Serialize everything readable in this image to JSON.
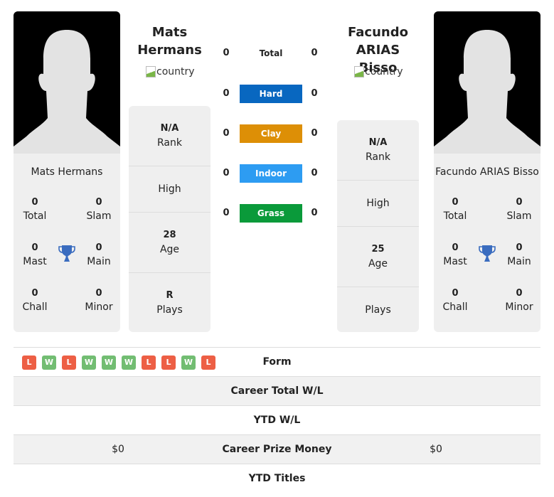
{
  "colors": {
    "hard": "#0867c0",
    "clay": "#dd8f06",
    "indoor": "#2d9cf2",
    "grass": "#0a9a3a",
    "win": "#72bd72",
    "loss": "#ed5f45",
    "trophy": "#3a6cbf"
  },
  "player1": {
    "name": "Mats Hermans",
    "name_line1": "Mats",
    "name_line2": "Hermans",
    "flag_alt": "country",
    "rank": "N/A",
    "rank_label": "Rank",
    "high_label": "High",
    "age": "28",
    "age_label": "Age",
    "plays": "R",
    "plays_label": "Plays",
    "titles": {
      "total": "0",
      "total_label": "Total",
      "slam": "0",
      "slam_label": "Slam",
      "mast": "0",
      "mast_label": "Mast",
      "main": "0",
      "main_label": "Main",
      "chall": "0",
      "chall_label": "Chall",
      "minor": "0",
      "minor_label": "Minor"
    }
  },
  "player2": {
    "name": "Facundo ARIAS Bisso",
    "name_line1": "Facundo ARIAS",
    "name_line2": "Bisso",
    "flag_alt": "country",
    "rank": "N/A",
    "rank_label": "Rank",
    "high_label": "High",
    "age": "25",
    "age_label": "Age",
    "plays": "",
    "plays_label": "Plays",
    "titles": {
      "total": "0",
      "total_label": "Total",
      "slam": "0",
      "slam_label": "Slam",
      "mast": "0",
      "mast_label": "Mast",
      "main": "0",
      "main_label": "Main",
      "chall": "0",
      "chall_label": "Chall",
      "minor": "0",
      "minor_label": "Minor"
    }
  },
  "h2h": [
    {
      "label": "Total",
      "p1": "0",
      "p2": "0",
      "surface": "total"
    },
    {
      "label": "Hard",
      "p1": "0",
      "p2": "0",
      "surface": "hard"
    },
    {
      "label": "Clay",
      "p1": "0",
      "p2": "0",
      "surface": "clay"
    },
    {
      "label": "Indoor",
      "p1": "0",
      "p2": "0",
      "surface": "indoor"
    },
    {
      "label": "Grass",
      "p1": "0",
      "p2": "0",
      "surface": "grass"
    }
  ],
  "form": [
    "L",
    "W",
    "L",
    "W",
    "W",
    "W",
    "L",
    "L",
    "W",
    "L"
  ],
  "table": {
    "form_label": "Form",
    "career_wl_label": "Career Total W/L",
    "career_wl_p1": "",
    "career_wl_p2": "",
    "ytd_wl_label": "YTD W/L",
    "ytd_wl_p1": "",
    "ytd_wl_p2": "",
    "prize_label": "Career Prize Money",
    "prize_p1": "$0",
    "prize_p2": "$0",
    "ytd_titles_label": "YTD Titles",
    "ytd_titles_p1": "",
    "ytd_titles_p2": ""
  }
}
